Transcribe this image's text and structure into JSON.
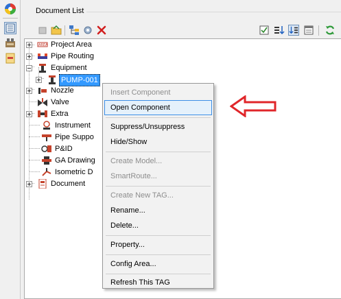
{
  "colors": {
    "accent": "#3399ff",
    "arrow_red": "#e0262a",
    "menu_highlight_border": "#3a8ee6"
  },
  "left_toolbar": {
    "items": [
      {
        "icon": "color-wheel-icon"
      },
      {
        "icon": "document-list-icon"
      },
      {
        "icon": "property-manager-icon"
      },
      {
        "icon": "pipe-routing-icon"
      }
    ]
  },
  "panel": {
    "title": "Document List"
  },
  "toolbar": {
    "left_buttons": [
      "open-icon",
      "folder-icon",
      "tree-icon",
      "settings-icon",
      "delete-icon"
    ],
    "right_buttons": [
      "check-icon",
      "sort-icon",
      "sort-alt-icon",
      "sheet-icon",
      "refresh-icon"
    ]
  },
  "tree": {
    "items": [
      {
        "label": "Project Area",
        "icon": "project-area-icon"
      },
      {
        "label": "Pipe Routing",
        "icon": "pipe-routing-icon"
      },
      {
        "label": "Equipment",
        "icon": "equipment-icon"
      },
      {
        "label": "PUMP-001",
        "icon": "pump-icon"
      },
      {
        "label": "Nozzle",
        "icon": "nozzle-icon"
      },
      {
        "label": "Valve",
        "icon": "valve-icon"
      },
      {
        "label": "Extra",
        "icon": "extra-icon"
      },
      {
        "label": "Instrument",
        "icon": "instrument-icon"
      },
      {
        "label": "Pipe Suppo",
        "icon": "pipe-support-icon"
      },
      {
        "label": "P&ID",
        "icon": "pid-icon"
      },
      {
        "label": "GA Drawing",
        "icon": "ga-drawing-icon"
      },
      {
        "label": "Isometric D",
        "icon": "isometric-icon"
      },
      {
        "label": "Document",
        "icon": "document-icon"
      }
    ]
  },
  "context_menu": {
    "items": [
      {
        "label": "Insert Component",
        "enabled": false
      },
      {
        "label": "Open Component",
        "enabled": true,
        "highlighted": true
      },
      {
        "label": "Suppress/Unsuppress",
        "enabled": true
      },
      {
        "label": "Hide/Show",
        "enabled": true
      },
      {
        "label": "Create Model...",
        "enabled": false
      },
      {
        "label": "SmartRoute...",
        "enabled": false
      },
      {
        "label": "Create New TAG...",
        "enabled": false
      },
      {
        "label": "Rename...",
        "enabled": true
      },
      {
        "label": "Delete...",
        "enabled": true
      },
      {
        "label": "Property...",
        "enabled": true
      },
      {
        "label": "Config Area...",
        "enabled": true
      },
      {
        "label": "Refresh This TAG",
        "enabled": true
      }
    ]
  },
  "annotation": {
    "icon": "red-arrow-icon",
    "points_to": "Open Component"
  }
}
